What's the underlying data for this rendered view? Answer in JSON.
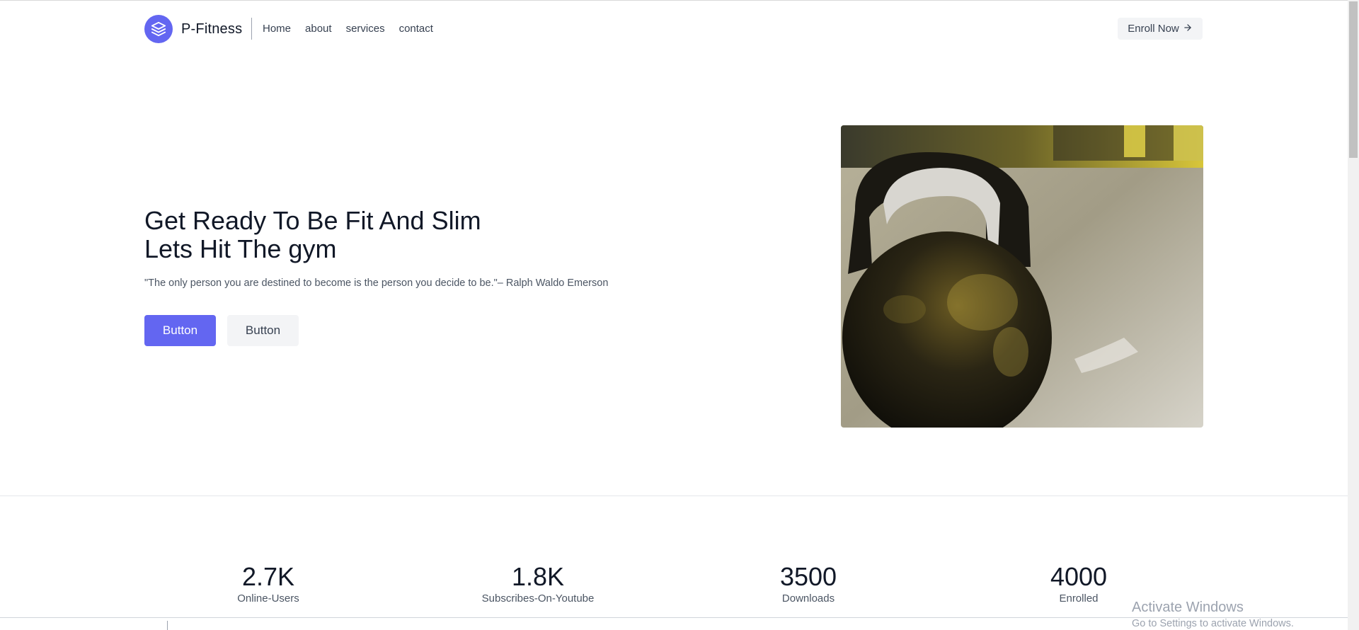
{
  "header": {
    "brand": "P-Fitness",
    "nav": [
      "Home",
      "about",
      "services",
      "contact"
    ],
    "cta_label": "Enroll Now",
    "cta_icon": "arrow-right-icon"
  },
  "hero": {
    "title_line1": "Get Ready To Be Fit And Slim",
    "title_line2": "Lets Hit The gym",
    "quote": "\"The only person you are destined to become is the person you decide to be.\"– Ralph Waldo Emerson",
    "primary_button": "Button",
    "secondary_button": "Button",
    "image": "kettlebell-photo"
  },
  "stats": [
    {
      "value": "2.7K",
      "label": "Online-Users"
    },
    {
      "value": "1.8K",
      "label": "Subscribes-On-Youtube"
    },
    {
      "value": "3500",
      "label": "Downloads"
    },
    {
      "value": "4000",
      "label": "Enrolled"
    }
  ],
  "watermark": {
    "line1": "Activate Windows",
    "line2": "Go to Settings to activate Windows."
  },
  "colors": {
    "accent": "#6366f1",
    "text": "#111827",
    "muted": "#4b5563",
    "button_secondary_bg": "#f3f4f6"
  }
}
